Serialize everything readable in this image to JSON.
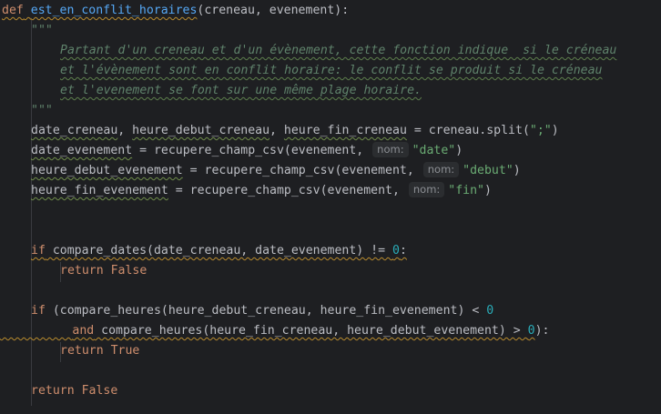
{
  "code": {
    "l1": {
      "kw": "def",
      "name": "est_en_conflit_horaires",
      "params": "(creneau, evenement):"
    },
    "l2": {
      "doc": "\"\"\""
    },
    "l3": {
      "doc": "Partant d'un creneau et d'un évènement, cette fonction indique  si le créneau"
    },
    "l4": {
      "doc": "et l'évènement sont en conflit horaire: le conflit se produit si le créneau"
    },
    "l5": {
      "doc": "et l'evenement se font sur une même plage horaire."
    },
    "l6": {
      "doc": "\"\"\""
    },
    "l7": {
      "a": "date_creneau",
      "b": ", ",
      "c": "heure_debut_creneau",
      "d": ", ",
      "e": "heure_fin_creneau",
      "f": " = creneau.split(",
      "g": "\";\"",
      "h": ")"
    },
    "l8": {
      "a": "date_evenement",
      "b": " = recupere_champ_csv(evenement, ",
      "hint": "nom:",
      "s": "\"date\"",
      "c": ")"
    },
    "l9": {
      "a": "heure_debut_evenement",
      "b": " = recupere_champ_csv(evenement, ",
      "hint": "nom:",
      "s": "\"debut\"",
      "c": ")"
    },
    "l10": {
      "a": "heure_fin_evenement",
      "b": " = recupere_champ_csv(evenement, ",
      "hint": "nom:",
      "s": "\"fin\"",
      "c": ")"
    },
    "l11": {
      "kw": "if",
      "a": " compare_dates(date_creneau, date_evenement) != ",
      "n": "0",
      "c": ":"
    },
    "l12": {
      "kw": "return",
      "v": "False"
    },
    "l13": {
      "kw": "if",
      "a": " (compare_heures(heure_debut_creneau, heure_fin_evenement) < ",
      "n": "0"
    },
    "l14": {
      "kw": "and",
      "a": " compare_heures(heure_fin_creneau, heure_debut_evenement) > ",
      "n": "0",
      "c": "):"
    },
    "l15": {
      "kw": "return",
      "v": "True"
    },
    "l16": {
      "kw": "return",
      "v": "False"
    }
  },
  "colors": {
    "background": "#1e1f22",
    "keyword": "#cf8e6d",
    "function": "#56a8f5",
    "number": "#2aacb8",
    "string": "#6aab73",
    "docstring": "#5f826b",
    "text": "#bcbec4",
    "hint_bg": "#2b2d30"
  }
}
